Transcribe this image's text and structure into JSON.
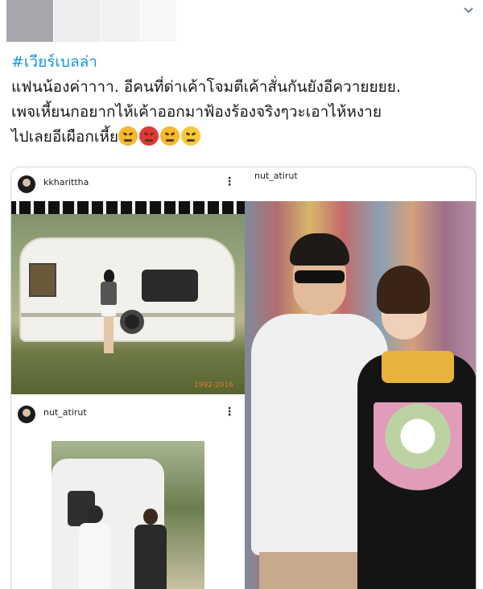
{
  "hashtag": "#เวียร์เบลล่า",
  "post": {
    "line1": "แฟนน้องค่าาาา.  อีคนที่ด่าเค้าโจมตีเค้าสั่นกันยังอีควายยยย.",
    "line2": "เพจเหี้ยนกอยากไห้เค้าออกมาฟ้องร้องจริงๆวะเอาไห้หงาย",
    "line3": "ไปเลยอีเผือกเหี้ย",
    "emojis": [
      "angry-face",
      "pouting-face",
      "angry-face",
      "face-with-rolling-eyes"
    ]
  },
  "collage": {
    "top_left": {
      "username": "kkharittha",
      "more": "⋮",
      "photo_year": "1992-2016"
    },
    "bottom_left": {
      "username": "nut_atirut",
      "more": "⋮"
    },
    "right": {
      "username": "nut_atirut"
    }
  },
  "colors": {
    "link": "#1b95e0",
    "text": "#14171a",
    "border": "#ccd6dd"
  }
}
